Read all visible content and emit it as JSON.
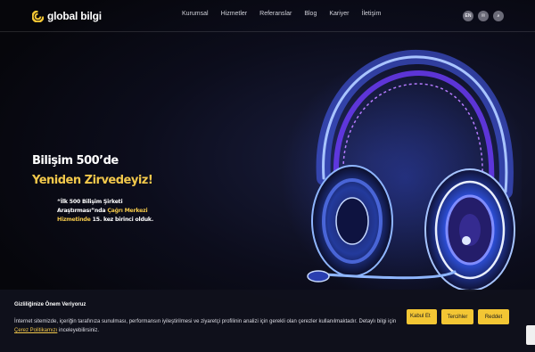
{
  "header": {
    "logo_text": "global bilgi",
    "nav": [
      "Kurumsal",
      "Hizmetler",
      "Referanslar",
      "Blog",
      "Kariyer",
      "İletişim"
    ],
    "icons": [
      {
        "name": "language-icon",
        "label": "EN"
      },
      {
        "name": "mail-icon",
        "label": "✉"
      },
      {
        "name": "search-icon",
        "label": "⌕"
      }
    ]
  },
  "hero": {
    "title_line1": "Bilişim 500’de",
    "title_line2": "Yeniden Zirvedeyiz!",
    "sub_part1": "“İlk 500 Bilişim Şirketi Araştırması”nda",
    "sub_part2": "Çağrı Merkezi Hizmetinde",
    "sub_part3": "15. kez birinci olduk."
  },
  "cookie": {
    "title": "Gizliliğinize Önem Veriyoruz",
    "text_before": "İnternet sitemizde, içeriğin tarafınıza sunulması, performansın iyileştirilmesi ve ziyaretçi profilinin analizi için gerekli olan çerezler kullanılmaktadır. Detaylı bilgi için ",
    "link": "Çerez Politikamızı",
    "text_after": " inceleyebilirsiniz.",
    "accept": "Kabul Et",
    "prefs": "Tercihler",
    "reject": "Reddet"
  },
  "colors": {
    "accent": "#f2c84b",
    "button": "#f3c634",
    "background": "#07070d"
  }
}
